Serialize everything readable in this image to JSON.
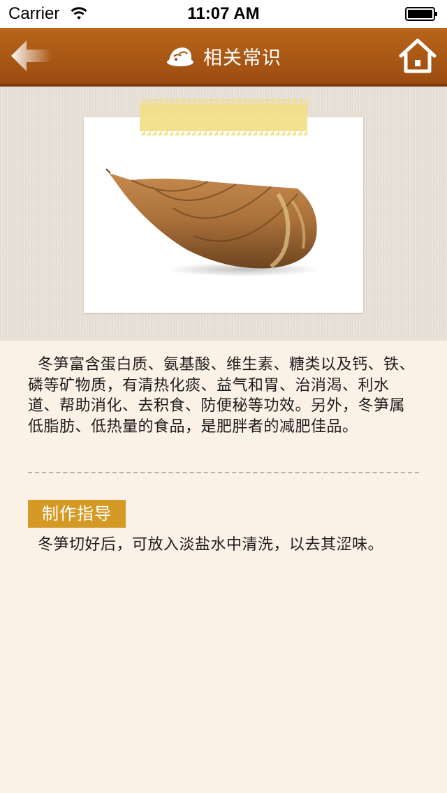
{
  "status_bar": {
    "carrier": "Carrier",
    "time": "11:07 AM"
  },
  "nav": {
    "title": "相关常识",
    "back_icon": "back-arrow-icon",
    "home_icon": "home-icon",
    "title_icon": "steamed-bun-icon",
    "bar_color": "#b05d17"
  },
  "article": {
    "photo_subject": "bamboo-shoot",
    "description": "冬笋富含蛋白质、氨基酸、维生素、糖类以及钙、铁、磷等矿物质，有清热化痰、益气和胃、治消渴、利水道、帮助消化、去积食、防便秘等功效。另外，冬笋属低脂肪、低热量的食品，是肥胖者的减肥佳品。",
    "section_label": "制作指导",
    "section_color": "#d49a25",
    "instruction": "冬笋切好后，可放入淡盐水中清洗，以去其涩味。"
  }
}
